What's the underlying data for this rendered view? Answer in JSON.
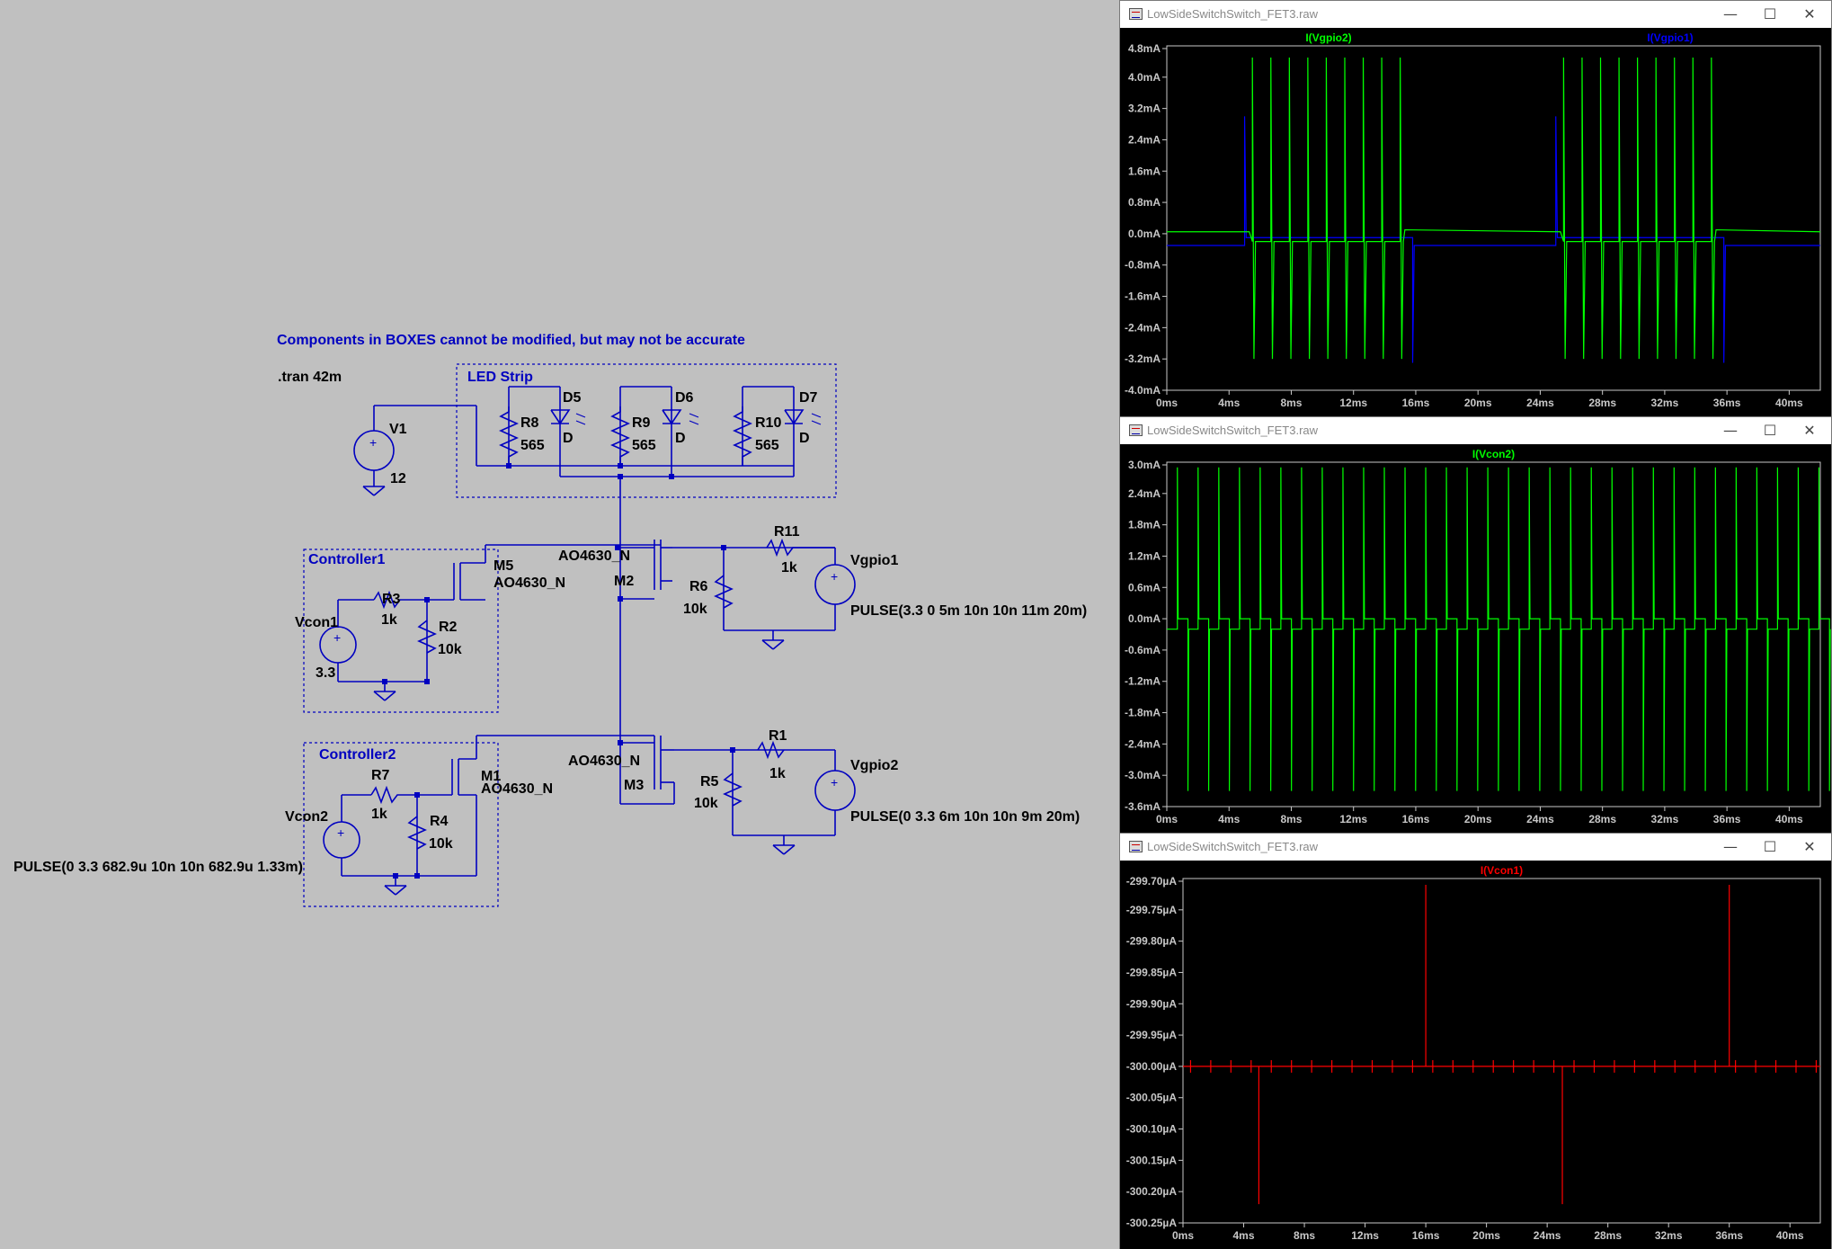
{
  "schematic": {
    "note": "Components in BOXES cannot be modified, but may not be accurate",
    "tran": ".tran 42m",
    "boxes": {
      "led_strip": "LED Strip",
      "controller1": "Controller1",
      "controller2": "Controller2"
    },
    "v1": {
      "name": "V1",
      "value": "12"
    },
    "r8": {
      "name": "R8",
      "value": "565"
    },
    "r9": {
      "name": "R9",
      "value": "565"
    },
    "r10": {
      "name": "R10",
      "value": "565"
    },
    "d5": {
      "name": "D5",
      "value": "D"
    },
    "d6": {
      "name": "D6",
      "value": "D"
    },
    "d7": {
      "name": "D7",
      "value": "D"
    },
    "m5": {
      "name": "M5",
      "value": "AO4630_N"
    },
    "m2": {
      "name": "M2",
      "value": "AO4630_N"
    },
    "m1": {
      "name": "M1",
      "value": "AO4630_N"
    },
    "m3": {
      "name": "M3",
      "value": "AO4630_N"
    },
    "r3": {
      "name": "R3",
      "value": "1k"
    },
    "r2": {
      "name": "R2",
      "value": "10k"
    },
    "r11": {
      "name": "R11",
      "value": "1k"
    },
    "r6": {
      "name": "R6",
      "value": "10k"
    },
    "r7": {
      "name": "R7",
      "value": "1k"
    },
    "r4": {
      "name": "R4",
      "value": "10k"
    },
    "r1": {
      "name": "R1",
      "value": "1k"
    },
    "r5": {
      "name": "R5",
      "value": "10k"
    },
    "vcon1": {
      "name": "Vcon1",
      "value": "3.3"
    },
    "vcon2": {
      "name": "Vcon2",
      "value": "PULSE(0 3.3 682.9u 10n 10n 682.9u 1.33m)"
    },
    "vgpio1": {
      "name": "Vgpio1",
      "value": "PULSE(3.3 0 5m 10n 10n 11m 20m)"
    },
    "vgpio2": {
      "name": "Vgpio2",
      "value": "PULSE(0 3.3 6m 10n 10n 9m 20m)"
    }
  },
  "windows": [
    {
      "title": "LowSideSwitchSwitch_FET3.raw",
      "buttons": {
        "min": "—",
        "max": "☐",
        "close": "✕"
      },
      "chart_data": {
        "type": "line",
        "series": [
          {
            "name": "I(Vgpio2)",
            "color": "#00ff00"
          },
          {
            "name": "I(Vgpio1)",
            "color": "#0000ff"
          }
        ],
        "x_ticks": [
          "0ms",
          "4ms",
          "8ms",
          "12ms",
          "16ms",
          "20ms",
          "24ms",
          "28ms",
          "32ms",
          "36ms",
          "40ms"
        ],
        "y_ticks": [
          "4.8mA",
          "4.0mA",
          "3.2mA",
          "2.4mA",
          "1.6mA",
          "0.8mA",
          "0.0mA",
          "-0.8mA",
          "-1.6mA",
          "-2.4mA",
          "-3.2mA",
          "-4.0mA"
        ],
        "xlim_ms": [
          0,
          42
        ],
        "ylim_mA": [
          -4.0,
          4.8
        ]
      }
    },
    {
      "title": "LowSideSwitchSwitch_FET3.raw",
      "buttons": {
        "min": "—",
        "max": "☐",
        "close": "✕"
      },
      "chart_data": {
        "type": "line",
        "series": [
          {
            "name": "I(Vcon2)",
            "color": "#00ff00"
          }
        ],
        "x_ticks": [
          "0ms",
          "4ms",
          "8ms",
          "12ms",
          "16ms",
          "20ms",
          "24ms",
          "28ms",
          "32ms",
          "36ms",
          "40ms"
        ],
        "y_ticks": [
          "3.0mA",
          "2.4mA",
          "1.8mA",
          "1.2mA",
          "0.6mA",
          "0.0mA",
          "-0.6mA",
          "-1.2mA",
          "-1.8mA",
          "-2.4mA",
          "-3.0mA",
          "-3.6mA"
        ],
        "xlim_ms": [
          0,
          42
        ],
        "ylim_mA": [
          -3.6,
          3.0
        ]
      }
    },
    {
      "title": "LowSideSwitchSwitch_FET3.raw",
      "buttons": {
        "min": "—",
        "max": "☐",
        "close": "✕"
      },
      "chart_data": {
        "type": "line",
        "series": [
          {
            "name": "I(Vcon1)",
            "color": "#ff0000"
          }
        ],
        "x_ticks": [
          "0ms",
          "4ms",
          "8ms",
          "12ms",
          "16ms",
          "20ms",
          "24ms",
          "28ms",
          "32ms",
          "36ms",
          "40ms"
        ],
        "y_ticks": [
          "-299.70µA",
          "-299.75µA",
          "-299.80µA",
          "-299.85µA",
          "-299.90µA",
          "-299.95µA",
          "-300.00µA",
          "-300.05µA",
          "-300.10µA",
          "-300.15µA",
          "-300.20µA",
          "-300.25µA"
        ],
        "xlim_ms": [
          0,
          42
        ],
        "ylim_uA": [
          -300.25,
          -299.7
        ]
      }
    }
  ]
}
